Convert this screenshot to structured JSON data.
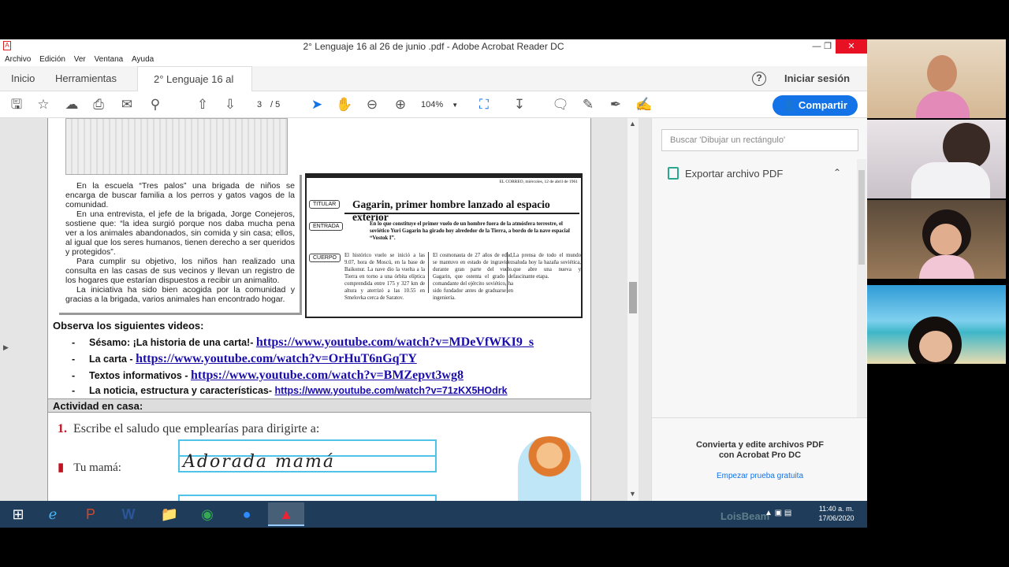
{
  "window": {
    "title": "2° Lenguaje 16 al 26 de junio .pdf - Adobe Acrobat Reader DC",
    "app_icon": "A"
  },
  "menu": [
    "Archivo",
    "Edición",
    "Ver",
    "Ventana",
    "Ayuda"
  ],
  "tabs": {
    "home": "Inicio",
    "tools": "Herramientas",
    "document": "2° Lenguaje 16 al 2...",
    "close": "×",
    "help": "?",
    "signin": "Iniciar sesión"
  },
  "toolbar": {
    "page_current": "3",
    "page_total": "/  5",
    "zoom": "104%",
    "share": "Compartir"
  },
  "document": {
    "story_paragraphs": [
      "En la escuela “Tres palos” una brigada de niños se encarga de buscar familia a los perros y gatos vagos de la comunidad.",
      "En una entrevista, el jefe de la brigada, Jorge Conejeros, sostiene que: “la idea surgió porque nos daba mucha pena ver a los animales abandonados, sin comida y sin casa; ellos, al igual que los seres humanos, tienen derecho a ser queridos y protegidos”.",
      "Para cumplir su objetivo, los niños han realizado una consulta en las casas de sus vecinos y llevan un registro de los hogares que estarían dispuestos a recibir un animalito.",
      "La iniciativa ha sido bien acogida por la comunidad y gracias a la brigada, varios animales han encontrado hogar."
    ],
    "news": {
      "dateline": "EL CORREO, miércoles, 12 de abril de 1961",
      "label_title": "TITULAR",
      "label_lead": "ENTRADA",
      "label_body": "CUERPO",
      "headline": "Gagarin, primer hombre lanzado al espacio exterior",
      "lead": "En lo que constituye el primer vuelo de un hombre fuera de la atmósfera terrestre, el soviético Yuri Gagarin ha girado hoy alrededor de la Tierra, a bordo de la nave espacial “Vostok I”.",
      "col1": "El histórico vuelo se inició a las 9.07, hora de Moscú, en la base de Baikonur. La nave dio la vuelta a la Tierra en torno a una órbita elíptica comprendida entre 175 y 327 km de altura y aterrizó a las 10.55 en Smelovka cerca de Saratov.",
      "col2": "El cosmonauta de 27 años de edad, se mantuvo en estado de ingravidez durante gran parte del vuelo. Gagarin, que ostenta el grado de comandante del ejército soviético, ha sido fundador antes de graduarse en ingeniería.",
      "col3": "La prensa de todo el mundo saluda hoy la hazaña soviética, que abre una nueva y fascinante etapa."
    },
    "videos_heading": "Observa los siguientes videos:",
    "videos": [
      {
        "label": "Sésamo: ¡La historia de una carta!- ",
        "url": "https://www.youtube.com/watch?v=MDeVfWKI9_s"
      },
      {
        "label": "La carta - ",
        "url": "https://www.youtube.com/watch?v=OrHuT6nGqTY"
      },
      {
        "label": "Textos informativos - ",
        "url": "https://www.youtube.com/watch?v=BMZepvt3wg8"
      },
      {
        "label": "La noticia, estructura y características- ",
        "url": "https://www.youtube.com/watch?v=71zKX5HOdrk"
      }
    ],
    "dash": "-",
    "activity_heading": "Actividad en casa:",
    "exercise_num": "1.",
    "exercise_text": "Escribe el saludo que emplearías para dirigirte a:",
    "tu_mama": "Tu mamá:",
    "handwriting": "Adorada mamá"
  },
  "right_pane": {
    "search_placeholder": "Buscar 'Dibujar un rectángulo'",
    "export": "Exportar archivo PDF",
    "promo_line1": "Convierta y edite archivos PDF",
    "promo_line2": "con Acrobat Pro DC",
    "promo_link": "Empezar prueba gratuita"
  },
  "taskbar": {
    "time": "11:40 a. m.",
    "date": "17/06/2020",
    "watermark": "LoisBeam"
  },
  "colors": {
    "accent": "#1473e6",
    "link": "#1a0dab",
    "close_red": "#e81123",
    "taskbar": "#1f3d5a"
  }
}
